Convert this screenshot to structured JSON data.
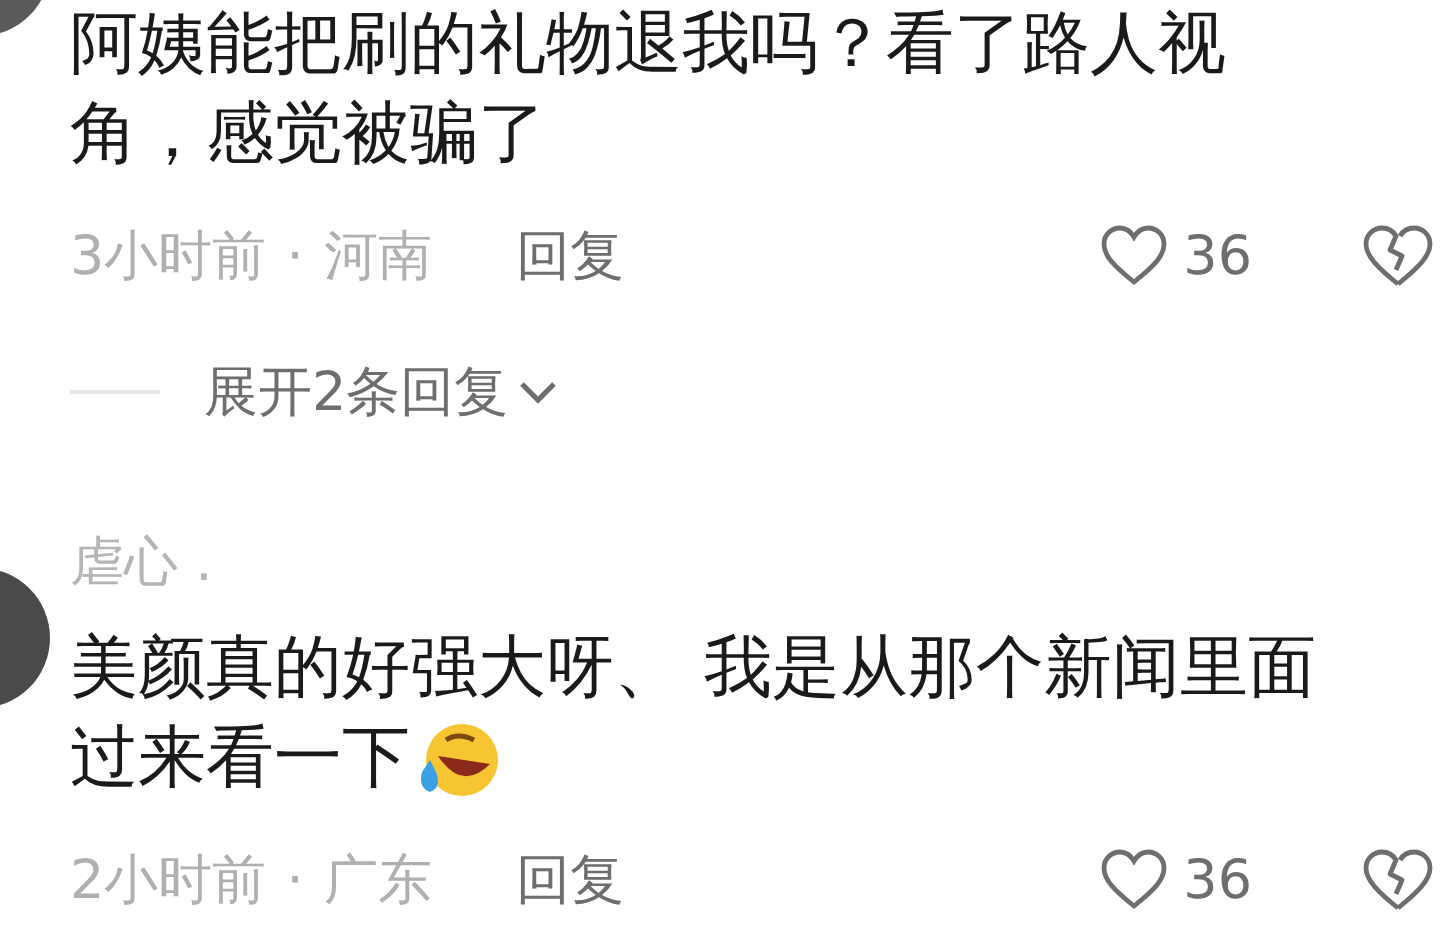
{
  "comments": [
    {
      "lines": [
        "阿姨能把刷的礼物退我吗？看了路人视",
        "角，感觉被骗了"
      ],
      "emoji": false,
      "time": "3小时前",
      "separator": "·",
      "location": "河南",
      "reply_label": "回复",
      "likes": "36",
      "expand_replies": "展开2条回复"
    },
    {
      "username": "虐心 .",
      "lines": [
        "美颜真的好强大呀、 我是从那个新闻里面",
        "过来看一下"
      ],
      "emoji": true,
      "time": "2小时前",
      "separator": "·",
      "location": "广东",
      "reply_label": "回复",
      "likes": "36"
    }
  ]
}
